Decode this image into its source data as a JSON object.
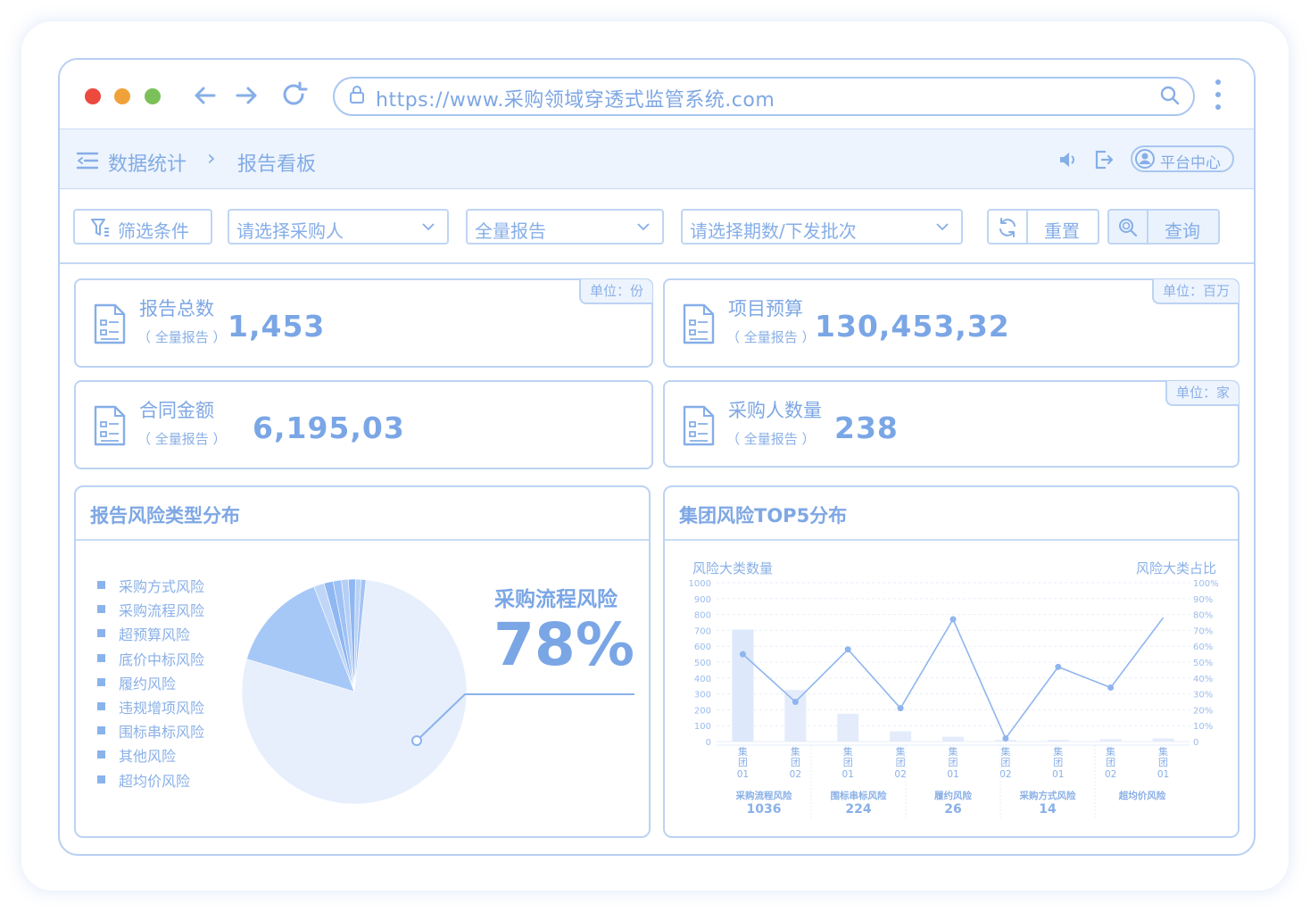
{
  "browser": {
    "url": "https://www.采购领域穿透式监管系统.com",
    "dot_colors": [
      "#ec4a3f",
      "#f0a23a",
      "#7cc05a"
    ]
  },
  "breadcrumb": {
    "root": "数据统计",
    "separator": "›",
    "current": "报告看板"
  },
  "appbar": {
    "platform_label": "平台中心"
  },
  "filters": {
    "conditions_label": "筛选条件",
    "purchaser_placeholder": "请选择采购人",
    "report_type_value": "全量报告",
    "period_placeholder": "请选择期数/下发批次",
    "reset_label": "重置",
    "query_label": "查询"
  },
  "stats": [
    {
      "title": "报告总数",
      "sub": "（ 全量报告 ）",
      "value": "1,453",
      "unit": "单位：份"
    },
    {
      "title": "项目预算",
      "sub": "（ 全量报告 ）",
      "value": "130,453,32",
      "unit": "单位：百万"
    },
    {
      "title": "合同金额",
      "sub": "（ 全量报告 ）",
      "value": "6,195,03",
      "unit": ""
    },
    {
      "title": "采购人数量",
      "sub": "（ 全量报告 ）",
      "value": "238",
      "unit": "单位：家"
    }
  ],
  "risk_type_panel": {
    "title": "报告风险类型分布",
    "legend": [
      "采购方式风险",
      "采购流程风险",
      "超预算风险",
      "底价中标风险",
      "履约风险",
      "违规增项风险",
      "围标串标风险",
      "其他风险",
      "超均价风险"
    ],
    "highlight_label": "采购流程风险",
    "highlight_value": "78%"
  },
  "top5_panel": {
    "title": "集团风险TOP5分布",
    "left_axis_title": "风险大类数量",
    "right_axis_title": "风险大类占比",
    "left_ticks": [
      "1000",
      "900",
      "800",
      "700",
      "600",
      "500",
      "400",
      "300",
      "200",
      "100",
      "0"
    ],
    "right_ticks": [
      "100%",
      "90%",
      "80%",
      "70%",
      "60%",
      "50%",
      "40%",
      "30%",
      "20%",
      "10%",
      "0"
    ],
    "group_labels": [
      {
        "name": "采购流程风险",
        "count": "1036"
      },
      {
        "name": "围标串标风险",
        "count": "224"
      },
      {
        "name": "履约风险",
        "count": "26"
      },
      {
        "name": "采购方式风险",
        "count": "14"
      },
      {
        "name": "超均价风险",
        "count": ""
      }
    ]
  },
  "chart_data": [
    {
      "type": "pie",
      "title": "报告风险类型分布",
      "categories": [
        "采购流程风险",
        "采购方式风险",
        "超预算风险",
        "底价中标风险",
        "履约风险",
        "违规增项风险",
        "围标串标风险",
        "其他风险",
        "超均价风险"
      ],
      "values": [
        78,
        14.5,
        1.5,
        1.3,
        1.2,
        1,
        1,
        0.8,
        0.7
      ],
      "colors": [
        "#e7effc",
        "#a6c8f7",
        "#bfd6f8",
        "#8fb7f1",
        "#9fc2f5",
        "#b5cff6",
        "#8fb7f1",
        "#b8d1f6",
        "#a3c4f3"
      ]
    },
    {
      "type": "bar",
      "title": "集团风险TOP5分布",
      "categories": [
        "集团01",
        "集团02",
        "集团01",
        "集团02",
        "集团01",
        "集团02",
        "集团01",
        "集团02",
        "集团01"
      ],
      "ylim": [
        0,
        1000
      ],
      "y2lim": [
        0,
        100
      ],
      "series": [
        {
          "name": "风险大类数量",
          "type": "bar",
          "values": [
            705,
            325,
            175,
            65,
            30,
            10,
            10,
            15,
            20
          ]
        },
        {
          "name": "风险大类占比",
          "type": "line",
          "axis": "right",
          "values": [
            55,
            25,
            58,
            21,
            77,
            2,
            47,
            34,
            78
          ]
        }
      ]
    }
  ]
}
